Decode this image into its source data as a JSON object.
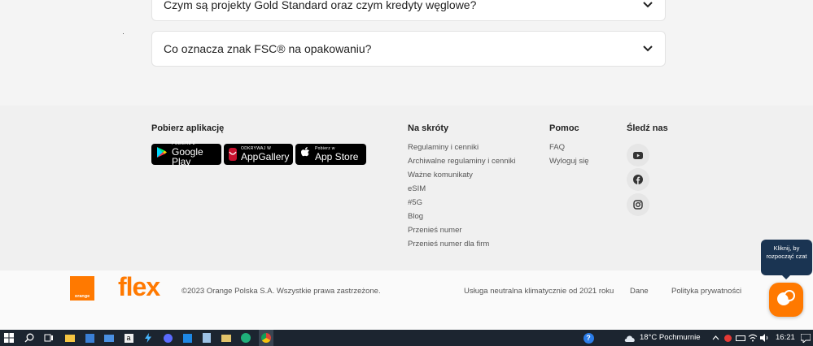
{
  "faq": {
    "items": [
      {
        "question": "Czym są projekty Gold Standard oraz czym kredyty węglowe?"
      },
      {
        "question": "Co oznacza znak FSC® na opakowaniu?"
      }
    ]
  },
  "footer": {
    "apps": {
      "title": "Pobierz aplikację",
      "google": {
        "small": "POBIERZ Z",
        "big": "Google Play"
      },
      "huawei": {
        "small": "ODKRYWAJ W",
        "big": "AppGallery",
        "logo_text": "HUAWEI"
      },
      "apple": {
        "small": "Pobierz w",
        "big": "App Store"
      }
    },
    "shortcuts": {
      "title": "Na skróty",
      "links": [
        "Regulaminy i cenniki",
        "Archiwalne regulaminy i cenniki",
        "Ważne komunikaty",
        "eSIM",
        "#5G",
        "Blog",
        "Przenieś numer",
        "Przenieś numer dla firm"
      ]
    },
    "help": {
      "title": "Pomoc",
      "links": [
        "FAQ",
        "Wyloguj się"
      ]
    },
    "follow": {
      "title": "Śledź nas",
      "icons": [
        "youtube-icon",
        "facebook-icon",
        "instagram-icon"
      ]
    }
  },
  "bottom": {
    "orange_logo_text": "orange",
    "flex_logo_text": "flex",
    "copyright": "©2023 Orange Polska S.A. Wszystkie prawa zastrzeżone.",
    "links": [
      "Usługa neutralna klimatycznie od 2021 roku",
      "Dane",
      "Polityka prywatności"
    ]
  },
  "chat": {
    "tooltip": "Kliknij, by rozpocząć czat"
  },
  "taskbar": {
    "weather": "18°C  Pochmurnie",
    "time": "16:21"
  },
  "colors": {
    "brand": "#ff7900",
    "chat_tooltip": "#1a3452",
    "taskbar": "#1c2530"
  }
}
